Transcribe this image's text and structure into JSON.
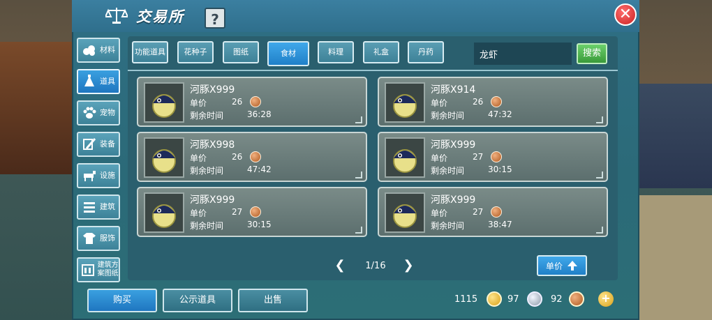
{
  "title": "交易所",
  "help_label": "?",
  "close_label": "✕",
  "sidebar": {
    "items": [
      {
        "label": "材料",
        "icon": "material-icon"
      },
      {
        "label": "道具",
        "icon": "tool-icon",
        "active": true
      },
      {
        "label": "宠物",
        "icon": "paw-icon"
      },
      {
        "label": "装备",
        "icon": "equipment-icon"
      },
      {
        "label": "设施",
        "icon": "facility-icon"
      },
      {
        "label": "建筑",
        "icon": "building-icon"
      },
      {
        "label": "服饰",
        "icon": "clothing-icon"
      },
      {
        "label": "建筑方案图纸",
        "icon": "blueprint-icon"
      }
    ]
  },
  "tabs": [
    {
      "label": "功能道具"
    },
    {
      "label": "花种子"
    },
    {
      "label": "图纸"
    },
    {
      "label": "食材",
      "active": true
    },
    {
      "label": "料理"
    },
    {
      "label": "礼盒"
    },
    {
      "label": "丹药"
    }
  ],
  "search": {
    "value": "龙虾",
    "button_label": "搜索"
  },
  "labels": {
    "unit_price": "单价",
    "remaining_time": "剩余时间"
  },
  "items": [
    {
      "name": "河豚X999",
      "price": "26",
      "time": "36:28"
    },
    {
      "name": "河豚X914",
      "price": "26",
      "time": "47:32"
    },
    {
      "name": "河豚X998",
      "price": "26",
      "time": "47:42"
    },
    {
      "name": "河豚X999",
      "price": "27",
      "time": "30:15"
    },
    {
      "name": "河豚X999",
      "price": "27",
      "time": "30:15"
    },
    {
      "name": "河豚X999",
      "price": "27",
      "time": "38:47"
    }
  ],
  "pager": {
    "text": "1/16",
    "prev": "❮",
    "next": "❯"
  },
  "sort_label": "单价",
  "bottom": {
    "buy_label": "购买",
    "public_label": "公示道具",
    "sell_label": "出售",
    "gold": "1115",
    "silver": "97",
    "bronze": "92",
    "add_label": "+"
  },
  "colors": {
    "accent": "#2080c8",
    "panel": "#2c6e76",
    "close": "#c92020"
  }
}
